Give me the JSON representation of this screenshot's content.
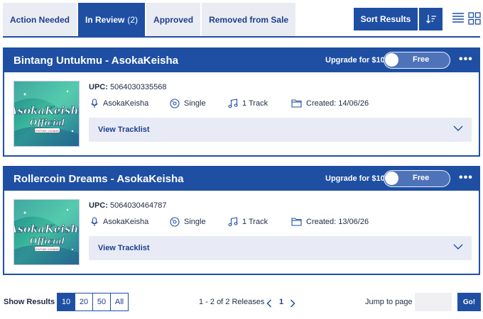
{
  "tabs": [
    {
      "label": "Action Needed"
    },
    {
      "label": "In Review",
      "count": "(2)"
    },
    {
      "label": "Approved"
    },
    {
      "label": "Removed from Sale"
    }
  ],
  "toolbar": {
    "sort_label": "Sort Results",
    "sort_icon": "sort-order-icon",
    "list_view_icon": "list-view-icon",
    "grid_view_icon": "grid-view-icon"
  },
  "releases": [
    {
      "title": "Bintang Untukmu - AsokaKeisha",
      "upgrade": "Upgrade for $10",
      "toggle": "Free",
      "upc_label": "UPC:",
      "upc": "5064030335568",
      "artist": "AsokaKeisha",
      "type": "Single",
      "tracks": "1 Track",
      "created": "Created: 14/06/26",
      "tracklist": "View Tracklist",
      "art": {
        "line1": "AsokaKeisha",
        "line2": "Official",
        "badge": "YOUTUBE CHANNEL"
      }
    },
    {
      "title": "Rollercoin Dreams - AsokaKeisha",
      "upgrade": "Upgrade for $10",
      "toggle": "Free",
      "upc_label": "UPC:",
      "upc": "5064030464787",
      "artist": "AsokaKeisha",
      "type": "Single",
      "tracks": "1 Track",
      "created": "Created: 13/06/26",
      "tracklist": "View Tracklist",
      "art": {
        "line1": "AsokaKeisha",
        "line2": "Official",
        "badge": "YOUTUBE CHANNEL"
      }
    }
  ],
  "footer": {
    "show_label": "Show Results",
    "per_page": [
      "10",
      "20",
      "50",
      "All"
    ],
    "per_page_selected": "10",
    "range": "1 - 2 of 2 Releases",
    "page": "1",
    "jump_label": "Jump to page",
    "jump_value": "",
    "go_label": "Go!"
  },
  "colors": {
    "primary": "#1e4fa3",
    "tab_bg": "#e9ecf2",
    "tracklist_bg": "#e8ebf6"
  }
}
